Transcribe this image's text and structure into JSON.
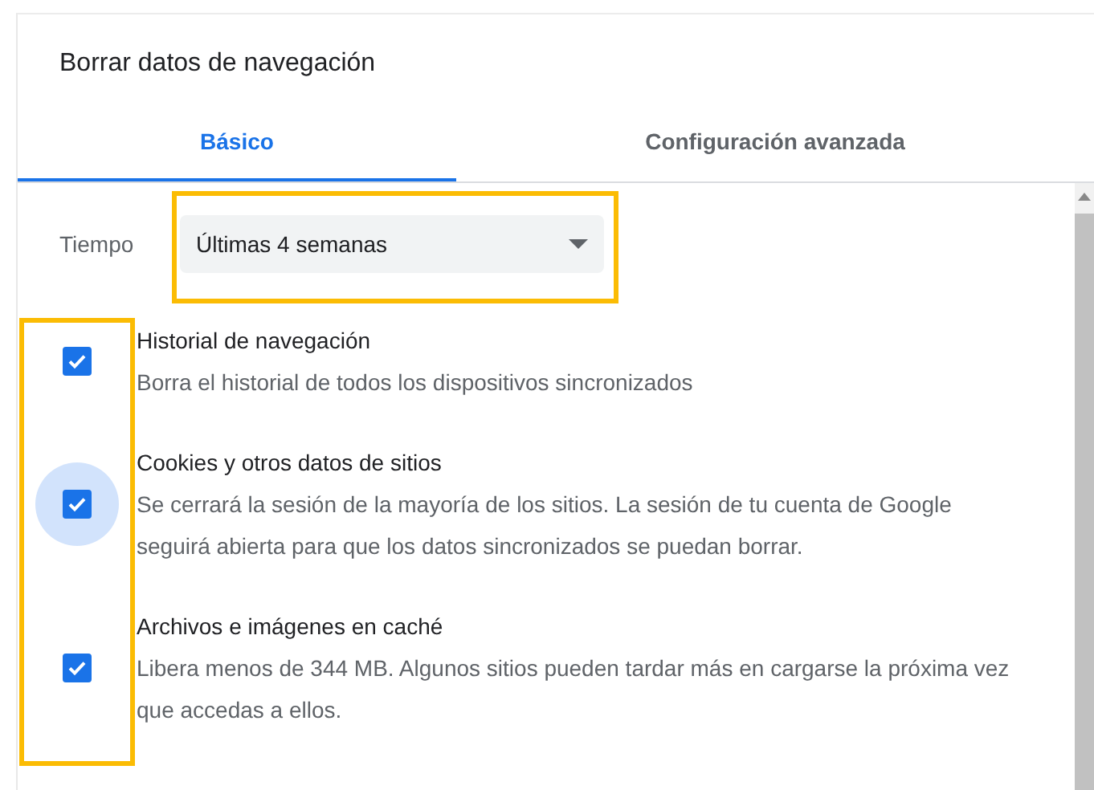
{
  "dialog": {
    "title": "Borrar datos de navegación"
  },
  "tabs": [
    {
      "label": "Básico",
      "selected": true
    },
    {
      "label": "Configuración avanzada",
      "selected": false
    }
  ],
  "time_range": {
    "label": "Tiempo",
    "value": "Últimas 4 semanas"
  },
  "options": [
    {
      "title": "Historial de navegación",
      "description": "Borra el historial de todos los dispositivos sincronizados",
      "checked": true,
      "focused": false
    },
    {
      "title": "Cookies y otros datos de sitios",
      "description": "Se cerrará la sesión de la mayoría de los sitios. La sesión de tu cuenta de Google seguirá abierta para que los datos sincronizados se puedan borrar.",
      "checked": true,
      "focused": true
    },
    {
      "title": "Archivos e imágenes en caché",
      "description": "Libera menos de 344 MB. Algunos sitios pueden tardar más en cargarse la próxima vez que accedas a ellos.",
      "checked": true,
      "focused": false
    }
  ]
}
